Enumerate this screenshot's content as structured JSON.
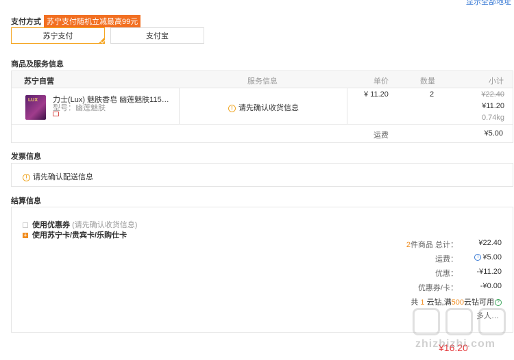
{
  "top_link": "显示全部地址",
  "payment": {
    "label": "支付方式",
    "promo": "苏宁支付随机立减最高99元",
    "options": [
      "苏宁支付",
      "支付宝"
    ]
  },
  "goods": {
    "section_title": "商品及服务信息",
    "headers": {
      "store": "苏宁自营",
      "service": "服务信息",
      "price": "单价",
      "qty": "数量",
      "subtotal": "小计"
    },
    "item": {
      "name": "力士(Lux) 魅肤香皂 幽莲魅肤115…",
      "model": "型号：幽莲魅肤",
      "service_hint": "请先确认收货信息",
      "unit_price": "¥ 11.20",
      "qty": "2",
      "subtotal_old": "¥22.40",
      "subtotal_new": "¥11.20",
      "weight": "0.74kg"
    },
    "freight_label": "运费",
    "freight_value": "¥5.00"
  },
  "invoice": {
    "section_title": "发票信息",
    "hint": "请先确认配送信息"
  },
  "settlement": {
    "section_title": "结算信息",
    "coupon_label": "使用优惠券",
    "coupon_hint": "(请先确认收货信息)",
    "card_label": "使用苏宁卡/贵宾卡/乐购仕卡",
    "count_prefix": "2",
    "count_suffix": "件商品 总计：",
    "total_value": "¥22.40",
    "freight_label": "运费：",
    "freight_value": "¥5.00",
    "discount_label": "优惠：",
    "discount_value": "-¥11.20",
    "coupon_card_label": "优惠券/卡：",
    "coupon_card_value": "-¥0.00",
    "yunzuan_p1": "共",
    "yunzuan_n1": "1",
    "yunzuan_p2": "云钻,满",
    "yunzuan_n2": "500",
    "yunzuan_p3": "云钻可用",
    "more": "多人…",
    "final_total": "¥16.20"
  },
  "watermark": "zhizhizhi.com",
  "colors": {
    "accent": "#f26f21",
    "link": "#3a7bd5",
    "price_red": "#e4393c"
  }
}
